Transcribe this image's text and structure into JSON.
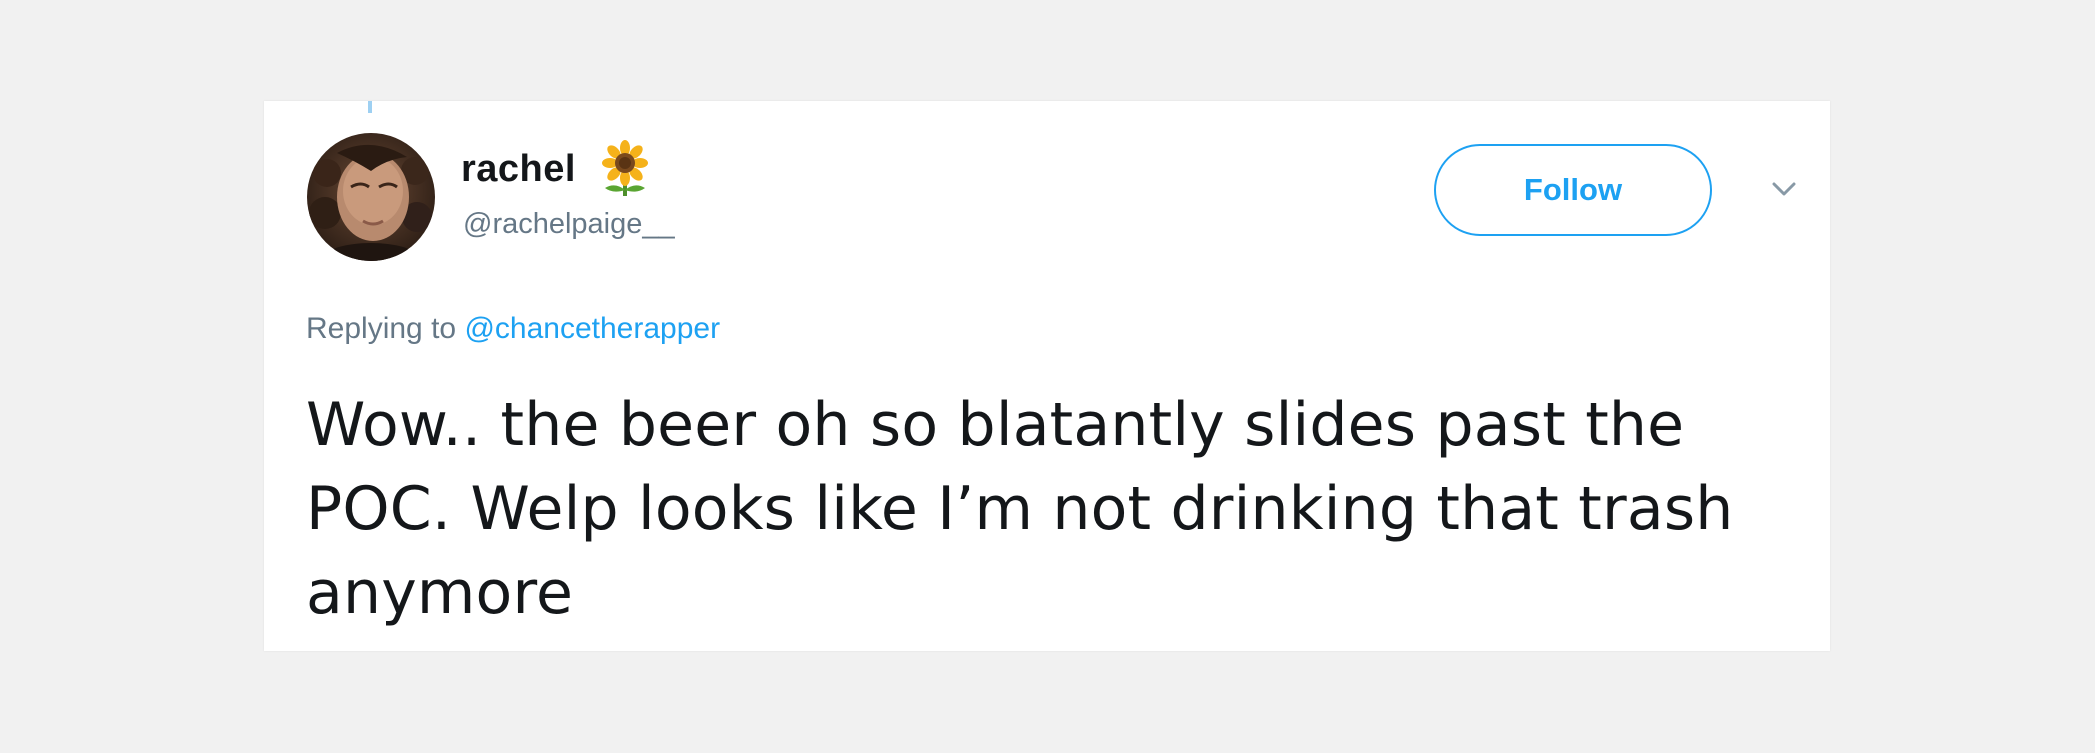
{
  "tweet": {
    "author": {
      "display_name": "rachel",
      "name_emoji": "sunflower-icon",
      "handle": "@rachelpaige__"
    },
    "follow_label": "Follow",
    "reply": {
      "prefix": "Replying to",
      "mention": "@chancetherapper"
    },
    "text": "Wow.. the beer oh so blatantly slides past the POC. Welp looks like I’m not drinking that trash anymore"
  },
  "colors": {
    "background": "#f1f1f1",
    "card": "#ffffff",
    "accent": "#1da1f2",
    "secondary_text": "#657786",
    "primary_text": "#14171a"
  }
}
